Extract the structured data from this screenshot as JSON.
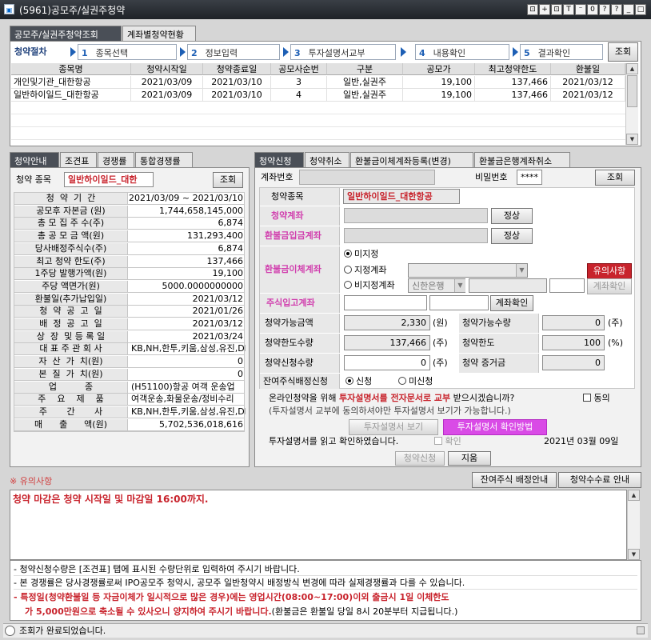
{
  "window": {
    "title": "(5961)공모주/실권주청약",
    "title_buttons": [
      "⊡",
      "+",
      "⊡",
      "T",
      "⁻",
      "0",
      "?",
      "?",
      "_",
      "□",
      "×"
    ]
  },
  "top_tabs": [
    "공모주/실권주청약조회",
    "계좌별청약현황"
  ],
  "steps": {
    "label": "청약절차",
    "items": [
      {
        "num": "1",
        "label": "종목선택"
      },
      {
        "num": "2",
        "label": "정보입력"
      },
      {
        "num": "3",
        "label": "투자설명서교부"
      },
      {
        "num": "4",
        "label": "내용확인"
      },
      {
        "num": "5",
        "label": "결과확인"
      }
    ],
    "query_button": "조회"
  },
  "grid": {
    "columns": [
      "종목명",
      "청약시작일",
      "청약종료일",
      "공모사순번",
      "구분",
      "공모가",
      "최고청약한도",
      "환불일"
    ],
    "rows": [
      [
        "개인및기관_대한항공",
        "2021/03/09",
        "2021/03/10",
        "3",
        "일반,실권주",
        "19,100",
        "137,466",
        "2021/03/12"
      ],
      [
        "일반하이일드_대한항공",
        "2021/03/09",
        "2021/03/10",
        "4",
        "일반,실권주",
        "19,100",
        "137,466",
        "2021/03/12"
      ]
    ]
  },
  "left_panel": {
    "tabs": [
      "청약안내",
      "조견표",
      "경쟁률",
      "통합경쟁률"
    ],
    "stock_label": "청약 종목",
    "stock_value": "일반하이일드_대한",
    "query_button": "조회",
    "rows": [
      {
        "label": "청  약  기  간",
        "value": "2021/03/09 ~ 2021/03/10"
      },
      {
        "label": "공모후 자본금 (원)",
        "value": "1,744,658,145,000"
      },
      {
        "label": "총 모 집 주 수(주)",
        "value": "6,874"
      },
      {
        "label": "총 공 모 금 액(원)",
        "value": "131,293,400"
      },
      {
        "label": "당사배정주식수(주)",
        "value": "6,874"
      },
      {
        "label": "최고 청약 한도(주)",
        "value": "137,466"
      },
      {
        "label": "1주당 발행가액(원)",
        "value": "19,100"
      },
      {
        "label": "주당 액면가(원)",
        "value": "5000.0000000000"
      },
      {
        "label": "환불일(추가납입일)",
        "value": "2021/03/12"
      },
      {
        "label": "청  약  공  고  일",
        "value": "2021/01/26"
      },
      {
        "label": "배  정  공  고  일",
        "value": "2021/03/12"
      },
      {
        "label": "상  장  및 등 록 일",
        "value": "2021/03/24"
      },
      {
        "label": "대 표 주 관 회 사",
        "value": "KB,NH,한투,키움,삼성,유진,DB"
      },
      {
        "label": "자  산  가  치(원)",
        "value": "0"
      },
      {
        "label": "본  질  가  치(원)",
        "value": "0"
      },
      {
        "label": "업          종",
        "value": "(H51100)항공 여객 운송업"
      },
      {
        "label": "주    요    제    품",
        "value": "여객운송,화물운송/정비수리"
      },
      {
        "label": "주       간       사",
        "value": "KB,NH,한투,키움,삼성,유진,DB"
      },
      {
        "label": "매      출      액(원)",
        "value": "5,702,536,018,616"
      }
    ]
  },
  "right_panel": {
    "tabs": [
      "청약신청",
      "청약취소",
      "환불금이체계좌등록(변경)",
      "환불금은행계좌취소"
    ],
    "account_label": "계좌번호",
    "password_label": "비밀번호",
    "password_value": "****",
    "query_button": "조회",
    "stock_label": "청약종목",
    "stock_value": "일반하이일드_대한항공",
    "subs_account_label": "청약계좌",
    "normal_badge": "정상",
    "refund_deposit_label": "환불금입금계좌",
    "refund_transfer_label": "환불금이체계좌",
    "radio_unassigned": "미지정",
    "radio_assigned": "지정계좌",
    "radio_nonassigned": "비지정계좌",
    "bank_value": "신한은행",
    "caution_button": "유의사항",
    "account_check_button": "계좌확인",
    "stock_deposit_label": "주식입고계좌",
    "available_amount_label": "청약가능금액",
    "available_amount_value": "2,330",
    "available_qty_label": "청약가능수량",
    "available_qty_value": "0",
    "limit_qty_label": "청약한도수량",
    "limit_qty_value": "137,466",
    "limit_pct_label": "청약한도",
    "limit_pct_value": "100",
    "apply_qty_label": "청약신청수량",
    "apply_qty_value": "0",
    "deposit_label": "청약 증거금",
    "deposit_value": "0",
    "unit_won": "(원)",
    "unit_share": "(주)",
    "unit_pct": "(%)",
    "residual_label": "잔여주식배정신청",
    "radio_apply": "신청",
    "radio_noapply": "미신청",
    "notice_line1_a": "온라인청약을 위해 ",
    "notice_line1_b": "투자설명서를 전자문서로 교부",
    "notice_line1_c": " 받으시겠습니까?",
    "agree_label": "동의",
    "notice_line2": "(투자설명서 교부에 동의하셔야만 투자설명서 보기가 가능합니다.)",
    "view_prospectus_button": "투자설명서 보기",
    "how_to_button": "투자설명서 확인방법",
    "read_confirm_label": "투자설명서를 읽고 확인하였습니다.",
    "confirm_label": "확인",
    "date_text": "2021년 03월 09일",
    "apply_button": "청약신청",
    "clear_button": "지움"
  },
  "caution": {
    "title": "※ 유의사항",
    "residual_guide_button": "잔여주식 배정안내",
    "fee_guide_button": "청약수수료 안내",
    "main_text": "청약 마감은 청약 시작일 및 마감일 16:00까지.",
    "notes": [
      "- 청약신청수량은 [조견표] 탭에 표시된 수량단위로 입력하여 주시기 바랍니다.",
      "- 본 경쟁률은 당사경쟁률로써 IPO공모주 청약시, 공모주 일반청약시 배정방식 변경에 따라 실제경쟁률과 다를 수 있습니다."
    ],
    "red_line1": "- 특정일(청약환불일 등 자금이체가 일시적으로 많은 경우)에는 영업시간(08:00~17:00)이외 출금시 1일 이체한도",
    "red_line2": "가 5,000만원으로 축소될 수 있사오니 양지하여 주시기 바랍니다.",
    "black_tail": "(환불금은 환불일 당일 8시 20분부터 지급됩니다.)"
  },
  "status": {
    "text": "조회가 완료되었습니다."
  }
}
